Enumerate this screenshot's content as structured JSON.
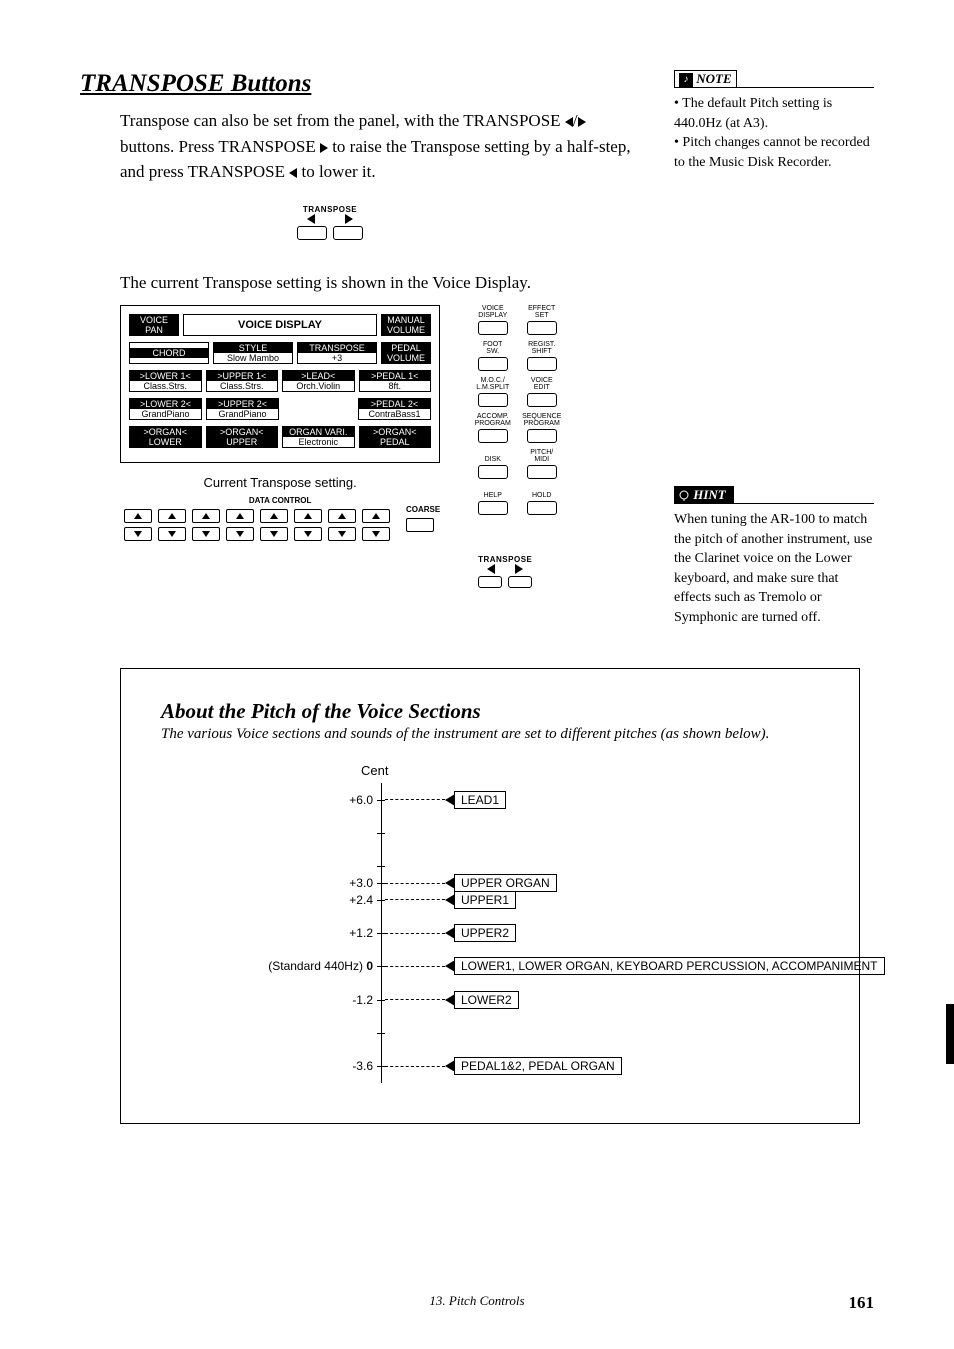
{
  "title": "TRANSPOSE Buttons",
  "intro1": "Transpose can also be set from the panel, with the TRANSPOSE ",
  "intro2": " buttons.  Press TRANSPOSE ",
  "intro3": " to raise the Transpose setting by a half-step, and press TRANSPOSE ",
  "intro4": " to lower it.",
  "transpose_label": "TRANSPOSE",
  "mid_text": "The current Transpose setting is shown in the Voice Display.",
  "note": {
    "header": "NOTE",
    "body": "• The default Pitch setting is 440.0Hz (at A3).\n• Pitch changes cannot be recorded to the Music Disk Recorder."
  },
  "hint": {
    "header": "HINT",
    "body": "When tuning the AR-100 to match the pitch of another instrument, use the Clarinet voice on the Lower keyboard, and make sure that effects such as Tremolo or Symphonic are turned off."
  },
  "voice_display": {
    "title": "VOICE DISPLAY",
    "caption": "Current Transpose setting.",
    "data_control": "DATA CONTROL",
    "coarse": "COARSE",
    "r1": {
      "voice_pan": "VOICE\nPAN",
      "manual": "MANUAL\nVOLUME"
    },
    "r2": {
      "chord": "CHORD",
      "style": "STYLE",
      "style_v": "Slow Mambo",
      "transpose": "TRANSPOSE",
      "transpose_v": "+3",
      "pedal": "PEDAL\nVOLUME"
    },
    "r3": {
      "l1": ">LOWER 1<",
      "l1v": "Class.Strs.",
      "u1": ">UPPER 1<",
      "u1v": "Class.Strs.",
      "ld": ">LEAD<",
      "ldv": "Orch.Violin",
      "p1": ">PEDAL 1<",
      "p1v": "8ft."
    },
    "r4": {
      "l2": ">LOWER 2<",
      "l2v": "GrandPiano",
      "u2": ">UPPER 2<",
      "u2v": "GrandPiano",
      "p2": ">PEDAL 2<",
      "p2v": "ContraBass1"
    },
    "r5": {
      "ol": ">ORGAN<",
      "olb": "LOWER",
      "ou": ">ORGAN<",
      "oub": "UPPER",
      "ov": "ORGAN VARI.",
      "ovb": "Electronic",
      "op": ">ORGAN<",
      "opb": "PEDAL"
    }
  },
  "panel": [
    [
      "VOICE\nDISPLAY",
      "EFFECT\nSET"
    ],
    [
      "FOOT\nSW.",
      "REGIST.\nSHIFT"
    ],
    [
      "M.O.C./\nL.M.SPLIT",
      "VOICE\nEDIT"
    ],
    [
      "ACCOMP.\nPROGRAM",
      "SEQUENCE\nPROGRAM"
    ],
    [
      "DISK",
      "PITCH/\nMIDI"
    ],
    [
      "HELP",
      "HOLD"
    ]
  ],
  "about": {
    "title": "About the Pitch of the Voice Sections",
    "sub": "The various Voice sections and sounds of the instrument are set to different pitches (as shown below).",
    "cent": "Cent",
    "standard": "(Standard 440Hz)"
  },
  "chart_data": {
    "type": "scatter",
    "title": "Pitch of Voice Sections",
    "ylabel": "Cent",
    "xlabel": "",
    "ylim": [
      -3.6,
      6.0
    ],
    "ticks": [
      6.0,
      3.0,
      2.4,
      1.2,
      0,
      -1.2,
      -3.6
    ],
    "tick_labels": [
      "+6.0",
      "+3.0",
      "+2.4",
      "+1.2",
      "0",
      "-1.2",
      "-3.6"
    ],
    "series": [
      {
        "name": "LEAD1",
        "y": 6.0
      },
      {
        "name": "UPPER ORGAN",
        "y": 3.0
      },
      {
        "name": "UPPER1",
        "y": 2.4
      },
      {
        "name": "UPPER2",
        "y": 1.2
      },
      {
        "name": "LOWER1, LOWER ORGAN, KEYBOARD PERCUSSION, ACCOMPANIMENT",
        "y": 0
      },
      {
        "name": "LOWER2",
        "y": -1.2
      },
      {
        "name": "PEDAL1&2, PEDAL ORGAN",
        "y": -3.6
      }
    ]
  },
  "footer": {
    "chapter": "13.",
    "title": "Pitch Controls",
    "page": "161"
  }
}
